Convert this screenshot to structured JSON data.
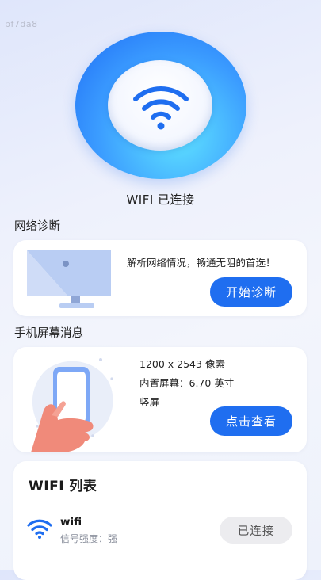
{
  "watermark": "bf7da8",
  "hero": {
    "status": "WIFI 已连接"
  },
  "diagnosis": {
    "section_title": "网络诊断",
    "description": "解析网络情况，畅通无阻的首选！",
    "button": "开始诊断"
  },
  "screen": {
    "section_title": "手机屏幕消息",
    "resolution": "1200 x 2543 像素",
    "size": "内置屏幕：6.70 英寸",
    "orientation": "竖屏",
    "button": "点击查看"
  },
  "wifi_list": {
    "title": "WIFI 列表",
    "items": [
      {
        "name": "wifi",
        "strength": "信号强度：强",
        "status": "已连接"
      }
    ]
  },
  "colors": {
    "primary": "#1f6ef0",
    "ring_outer": "#1f6cf5",
    "ring_inner": "#5fe3ff"
  }
}
